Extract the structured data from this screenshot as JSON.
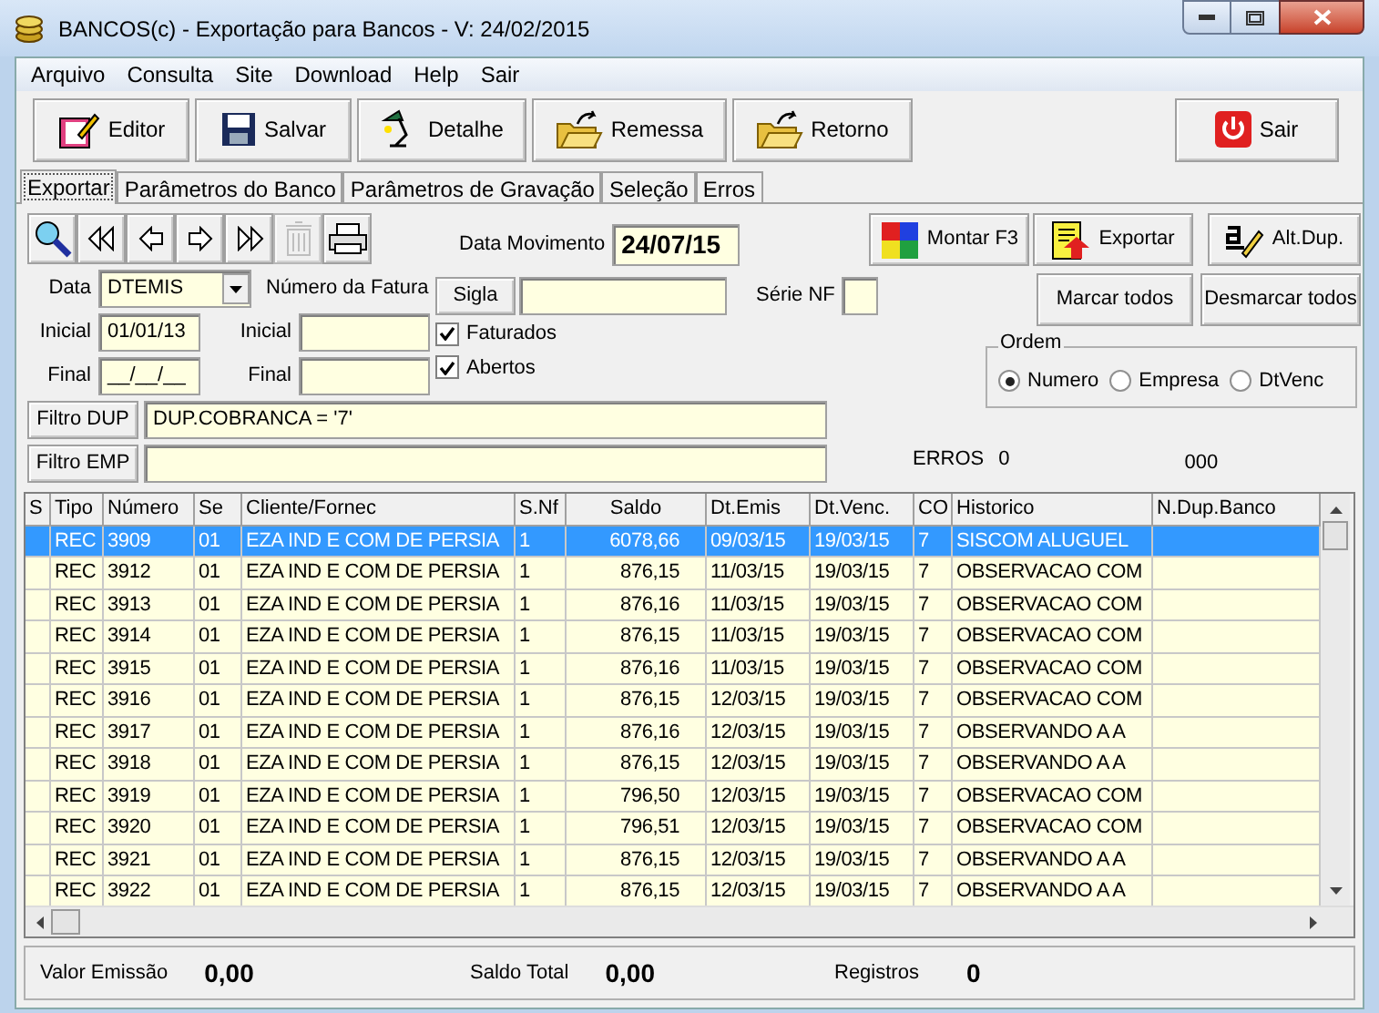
{
  "window": {
    "title": "BANCOS(c) - Exportação para Bancos - V: 24/02/2015"
  },
  "menu": [
    "Arquivo",
    "Consulta",
    "Site",
    "Download",
    "Help",
    "Sair"
  ],
  "toolbar": [
    {
      "kind": "editor",
      "label": "Editor"
    },
    {
      "kind": "save",
      "label": "Salvar"
    },
    {
      "kind": "lamp",
      "label": "Detalhe"
    },
    {
      "kind": "folder",
      "label": "Remessa"
    },
    {
      "kind": "folder",
      "label": "Retorno"
    },
    {
      "kind": "power",
      "label": "Sair"
    }
  ],
  "tabs": [
    {
      "label": "Exportar",
      "selected": true
    },
    {
      "label": "Parâmetros do Banco",
      "selected": false
    },
    {
      "label": "Parâmetros de Gravação",
      "selected": false
    },
    {
      "label": "Seleção",
      "selected": false
    },
    {
      "label": "Erros",
      "selected": false
    }
  ],
  "nav_buttons": [
    {
      "kind": "search",
      "disabled": false
    },
    {
      "kind": "first",
      "disabled": false
    },
    {
      "kind": "prev",
      "disabled": false
    },
    {
      "kind": "next",
      "disabled": false
    },
    {
      "kind": "last",
      "disabled": false
    },
    {
      "kind": "trash",
      "disabled": true
    },
    {
      "kind": "printer",
      "disabled": false
    }
  ],
  "data_movimento": {
    "label": "Data Movimento",
    "value": "24/07/15"
  },
  "action_buttons": [
    {
      "kind": "puzzle",
      "label": "Montar F3"
    },
    {
      "kind": "export",
      "label": "Exportar"
    },
    {
      "kind": "edit",
      "label": "Alt.Dup."
    }
  ],
  "data": {
    "label": "Data",
    "value": "DTEMIS"
  },
  "numero_fatura": {
    "label": "Número da Fatura"
  },
  "inicial": {
    "label": "Inicial",
    "value": "01/01/13"
  },
  "final": {
    "label": "Final",
    "value": "__/__/__"
  },
  "fatura_inicial": {
    "label": "Inicial"
  },
  "fatura_final": {
    "label": "Final"
  },
  "sigla": {
    "label": "Sigla"
  },
  "serie_nf": {
    "label": "Série NF"
  },
  "checks": [
    {
      "label": "Faturados",
      "checked": true
    },
    {
      "label": "Abertos",
      "checked": true
    }
  ],
  "mark_buttons": [
    "Marcar todos",
    "Desmarcar todos"
  ],
  "ordem": {
    "title": "Ordem",
    "options": [
      {
        "label": "Numero",
        "selected": true
      },
      {
        "label": "Empresa",
        "selected": false
      },
      {
        "label": "DtVenc",
        "selected": false
      }
    ]
  },
  "filtro_dup": {
    "label": "Filtro DUP",
    "value": "DUP.COBRANCA = '7'"
  },
  "filtro_emp": {
    "label": "Filtro EMP"
  },
  "erros": {
    "label": "ERROS",
    "value": "0"
  },
  "counter": "000",
  "table": {
    "columns": [
      "S",
      "Tipo",
      "Número",
      "Se",
      "Cliente/Fornec",
      "S.Nf",
      "Saldo",
      "Dt.Emis",
      "Dt.Venc.",
      "CO",
      "Historico",
      "N.Dup.Banco"
    ],
    "rows": [
      {
        "selected": true,
        "cells": [
          "",
          "REC",
          "3909",
          "01",
          "EZA IND E COM DE PERSIA",
          "1",
          "6078,66",
          "09/03/15",
          "19/03/15",
          "7",
          "SISCOM ALUGUEL",
          ""
        ]
      },
      {
        "selected": false,
        "cells": [
          "",
          "REC",
          "3912",
          "01",
          "EZA IND E COM DE PERSIA",
          "1",
          "876,15",
          "11/03/15",
          "19/03/15",
          "7",
          "OBSERVACAO COM",
          ""
        ]
      },
      {
        "selected": false,
        "cells": [
          "",
          "REC",
          "3913",
          "01",
          "EZA IND E COM DE PERSIA",
          "1",
          "876,16",
          "11/03/15",
          "19/03/15",
          "7",
          "OBSERVACAO COM",
          ""
        ]
      },
      {
        "selected": false,
        "cells": [
          "",
          "REC",
          "3914",
          "01",
          "EZA IND E COM DE PERSIA",
          "1",
          "876,15",
          "11/03/15",
          "19/03/15",
          "7",
          "OBSERVACAO COM",
          ""
        ]
      },
      {
        "selected": false,
        "cells": [
          "",
          "REC",
          "3915",
          "01",
          "EZA IND E COM DE PERSIA",
          "1",
          "876,16",
          "11/03/15",
          "19/03/15",
          "7",
          "OBSERVACAO COM",
          ""
        ]
      },
      {
        "selected": false,
        "cells": [
          "",
          "REC",
          "3916",
          "01",
          "EZA IND E COM DE PERSIA",
          "1",
          "876,15",
          "12/03/15",
          "19/03/15",
          "7",
          "OBSERVACAO COM",
          ""
        ]
      },
      {
        "selected": false,
        "cells": [
          "",
          "REC",
          "3917",
          "01",
          "EZA IND E COM DE PERSIA",
          "1",
          "876,16",
          "12/03/15",
          "19/03/15",
          "7",
          "OBSERVANDO A A",
          ""
        ]
      },
      {
        "selected": false,
        "cells": [
          "",
          "REC",
          "3918",
          "01",
          "EZA IND E COM DE PERSIA",
          "1",
          "876,15",
          "12/03/15",
          "19/03/15",
          "7",
          "OBSERVANDO A A",
          ""
        ]
      },
      {
        "selected": false,
        "cells": [
          "",
          "REC",
          "3919",
          "01",
          "EZA IND E COM DE PERSIA",
          "1",
          "796,50",
          "12/03/15",
          "19/03/15",
          "7",
          "OBSERVACAO COM",
          ""
        ]
      },
      {
        "selected": false,
        "cells": [
          "",
          "REC",
          "3920",
          "01",
          "EZA IND E COM DE PERSIA",
          "1",
          "796,51",
          "12/03/15",
          "19/03/15",
          "7",
          "OBSERVACAO COM",
          ""
        ]
      },
      {
        "selected": false,
        "cells": [
          "",
          "REC",
          "3921",
          "01",
          "EZA IND E COM DE PERSIA",
          "1",
          "876,15",
          "12/03/15",
          "19/03/15",
          "7",
          "OBSERVANDO A A",
          ""
        ]
      },
      {
        "selected": false,
        "cells": [
          "",
          "REC",
          "3922",
          "01",
          "EZA IND E COM DE PERSIA",
          "1",
          "876,15",
          "12/03/15",
          "19/03/15",
          "7",
          "OBSERVANDO A A",
          ""
        ]
      }
    ]
  },
  "status_bar": [
    {
      "label": "Valor Emissão",
      "value": "0,00"
    },
    {
      "label": "Saldo Total",
      "value": "0,00"
    },
    {
      "label": "Registros",
      "value": "0"
    }
  ]
}
